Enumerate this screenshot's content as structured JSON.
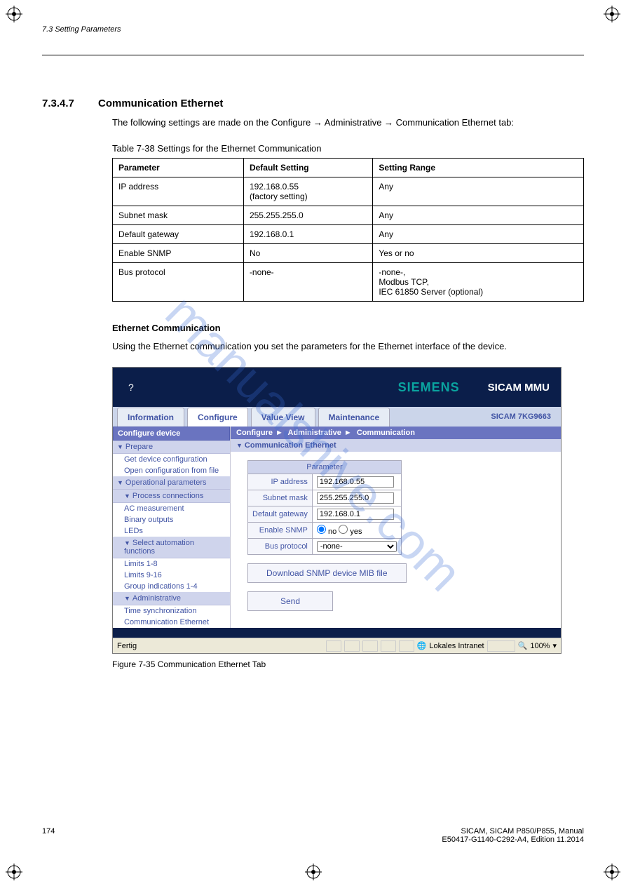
{
  "watermark": "manualshive.com",
  "header": {
    "section_num": "7.3.4.7",
    "section_title": "Communication Ethernet"
  },
  "intro": "The following settings are made on the Configure → Administrative → Communication Ethernet tab:",
  "table_caption": "Table 7-38  Settings for the Ethernet Communication",
  "settings": {
    "headers": [
      "Parameter",
      "Default Setting",
      "Setting Range"
    ],
    "rows": [
      [
        "IP address",
        "192.168.0.55\n(factory setting)",
        "Any"
      ],
      [
        "Subnet mask",
        "255.255.255.0",
        "Any"
      ],
      [
        "Default gateway",
        "192.168.0.1",
        "Any"
      ],
      [
        "Enable SNMP",
        "No",
        "Yes or no"
      ],
      [
        "Bus protocol",
        "-none-",
        "-none-,\nModbus TCP,\nIEC 61850 Server (optional)"
      ]
    ]
  },
  "subsection_title": "Ethernet Communication",
  "subsection_body": "Using the Ethernet communication you set the parameters for the Ethernet interface of the device.",
  "fig": {
    "brand": "SIEMENS",
    "product": "SICAM MMU",
    "help": "?",
    "tabs": [
      "Information",
      "Configure",
      "Value View",
      "Maintenance"
    ],
    "device": "SICAM 7KG9663",
    "sidebar_head": "Configure device",
    "sidebar_groups": {
      "prepare": "Prepare",
      "prepare_items": [
        "Get device configuration",
        "Open configuration from file"
      ],
      "op": "Operational parameters",
      "proc": "Process connections",
      "proc_items": [
        "AC measurement",
        "Binary outputs",
        "LEDs"
      ],
      "auto": "Select automation functions",
      "auto_items": [
        "Limits 1-8",
        "Limits 9-16",
        "Group indications 1-4"
      ],
      "admin": "Administrative",
      "admin_items": [
        "Time synchronization",
        "Communication Ethernet"
      ]
    },
    "breadcrumb": [
      "Configure",
      "Administrative",
      "Communication"
    ],
    "panel": "Communication Ethernet",
    "param_header": "Parameter",
    "params": {
      "ip_lbl": "IP address",
      "ip_val": "192.168.0.55",
      "mask_lbl": "Subnet mask",
      "mask_val": "255.255.255.0",
      "gw_lbl": "Default gateway",
      "gw_val": "192.168.0.1",
      "snmp_lbl": "Enable SNMP",
      "snmp_no": "no",
      "snmp_yes": "yes",
      "bus_lbl": "Bus protocol",
      "bus_val": "-none-"
    },
    "btn_download": "Download SNMP device MIB file",
    "btn_send": "Send",
    "status_left": "Fertig",
    "status_zone": "Lokales Intranet",
    "status_zoom": "100%"
  },
  "fig_caption": "Figure 7-35  Communication Ethernet Tab",
  "footer": {
    "page": "174",
    "doc": "SICAM, SICAM P850/P855, Manual",
    "ref": "E50417-G1140-C292-A4, Edition 11.2014"
  }
}
